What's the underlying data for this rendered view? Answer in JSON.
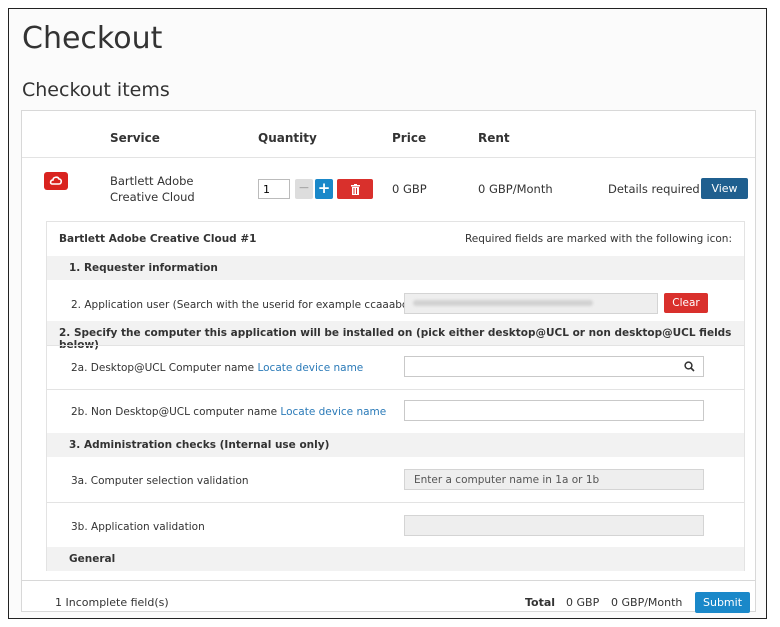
{
  "page": {
    "title": "Checkout",
    "section_title": "Checkout items"
  },
  "table": {
    "headers": {
      "service": "Service",
      "quantity": "Quantity",
      "price": "Price",
      "rent": "Rent"
    },
    "item": {
      "icon": "adobe-creative-cloud-icon",
      "name": "Bartlett Adobe Creative Cloud",
      "quantity": "1",
      "price": "0 GBP",
      "rent": "0 GBP/Month",
      "status": "Details required",
      "view_label": "View"
    }
  },
  "detail": {
    "title": "Bartlett Adobe Creative Cloud #1",
    "required_note": "Required fields are marked with the following icon:",
    "sections": {
      "requester": "1. Requester information",
      "computer": "2. Specify the computer this application will be installed on (pick either desktop@UCL or non desktop@UCL fields below)",
      "admin": "3. Administration checks (Internal use only)",
      "general": "General"
    },
    "fields": {
      "app_user_label": "2. Application user (Search with the userid for example ccaaabc)",
      "clear_label": "Clear",
      "desktop_label": "2a. Desktop@UCL Computer name",
      "desktop_link": "Locate device name",
      "non_desktop_label": "2b. Non Desktop@UCL computer name",
      "non_desktop_link": "Locate device name",
      "computer_validation_label": "3a. Computer selection validation",
      "computer_validation_value": "Enter a computer name in 1a or 1b",
      "app_validation_label": "3b. Application validation"
    }
  },
  "footer": {
    "incomplete": "1 Incomplete field(s)",
    "total_label": "Total",
    "total_price": "0 GBP",
    "total_rent": "0 GBP/Month",
    "submit_label": "Submit"
  },
  "colors": {
    "accent_blue": "#1a88c9",
    "danger_red": "#d9302c",
    "dark_blue": "#1f5f8f",
    "link": "#2a7ab8"
  }
}
